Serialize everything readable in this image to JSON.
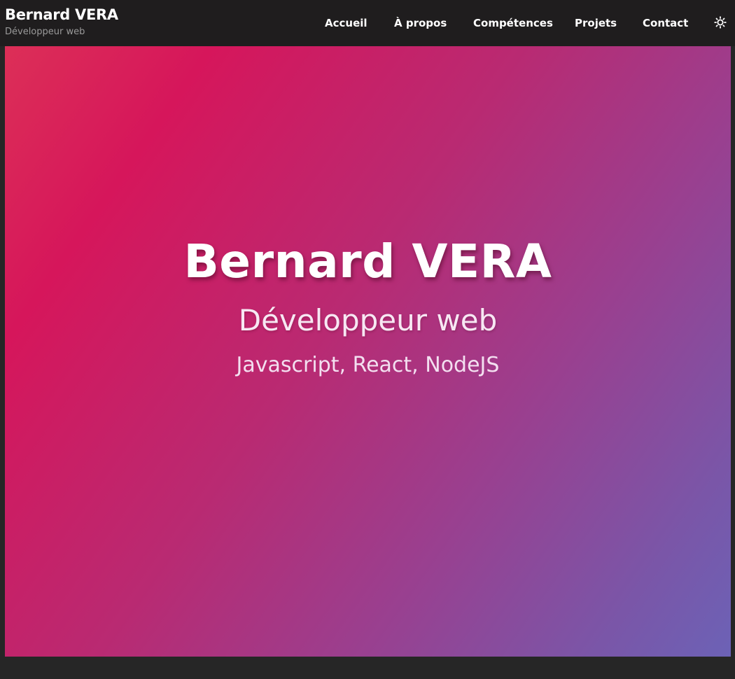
{
  "header": {
    "brand_name": "Bernard VERA",
    "brand_subtitle": "Développeur web",
    "nav": [
      {
        "label": "Accueil"
      },
      {
        "label": "À propos"
      },
      {
        "label": "Compétences"
      },
      {
        "label": "Projets"
      },
      {
        "label": "Contact"
      }
    ],
    "theme_toggle_icon": "sun-icon"
  },
  "hero": {
    "title": "Bernard VERA",
    "role": "Développeur web",
    "stack": "Javascript, React, NodeJS"
  },
  "colors": {
    "header_bg": "#1f1d1e",
    "page_bg": "#262626",
    "hero_gradient": [
      "#dc2f57",
      "#d6165b",
      "#b92a72",
      "#994090",
      "#7a56a8",
      "#6c62b6"
    ]
  }
}
